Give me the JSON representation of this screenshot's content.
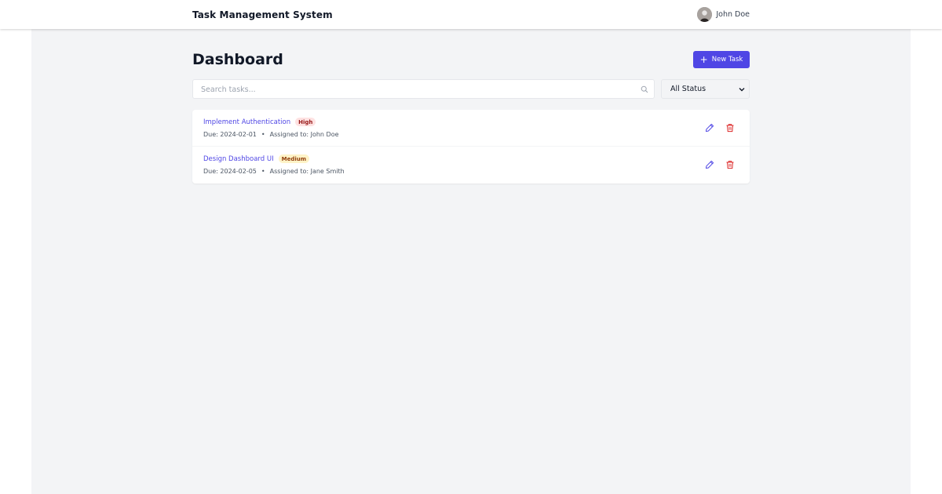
{
  "app": {
    "title": "Task Management System"
  },
  "user": {
    "name": "John Doe"
  },
  "page": {
    "title": "Dashboard"
  },
  "actions": {
    "new_task_label": "New Task",
    "new_task_icon": "plus-icon"
  },
  "search": {
    "placeholder": "Search tasks...",
    "value": "",
    "icon": "search-icon"
  },
  "filter": {
    "selected": "All Status",
    "icon": "chevron-down-icon"
  },
  "colors": {
    "accent": "#4f46e5",
    "danger": "#dc2626",
    "page_bg": "#f3f4f6",
    "high_badge_bg": "#fee2e2",
    "high_badge_text": "#991b1b",
    "medium_badge_bg": "#fef3c7",
    "medium_badge_text": "#92400e"
  },
  "tasks": [
    {
      "title": "Implement Authentication",
      "priority": "High",
      "due": "Due: 2024-02-01",
      "separator": "•",
      "assigned": "Assigned to: John Doe",
      "edit_icon": "pencil-icon",
      "delete_icon": "trash-icon"
    },
    {
      "title": "Design Dashboard UI",
      "priority": "Medium",
      "due": "Due: 2024-02-05",
      "separator": "•",
      "assigned": "Assigned to: Jane Smith",
      "edit_icon": "pencil-icon",
      "delete_icon": "trash-icon"
    }
  ]
}
